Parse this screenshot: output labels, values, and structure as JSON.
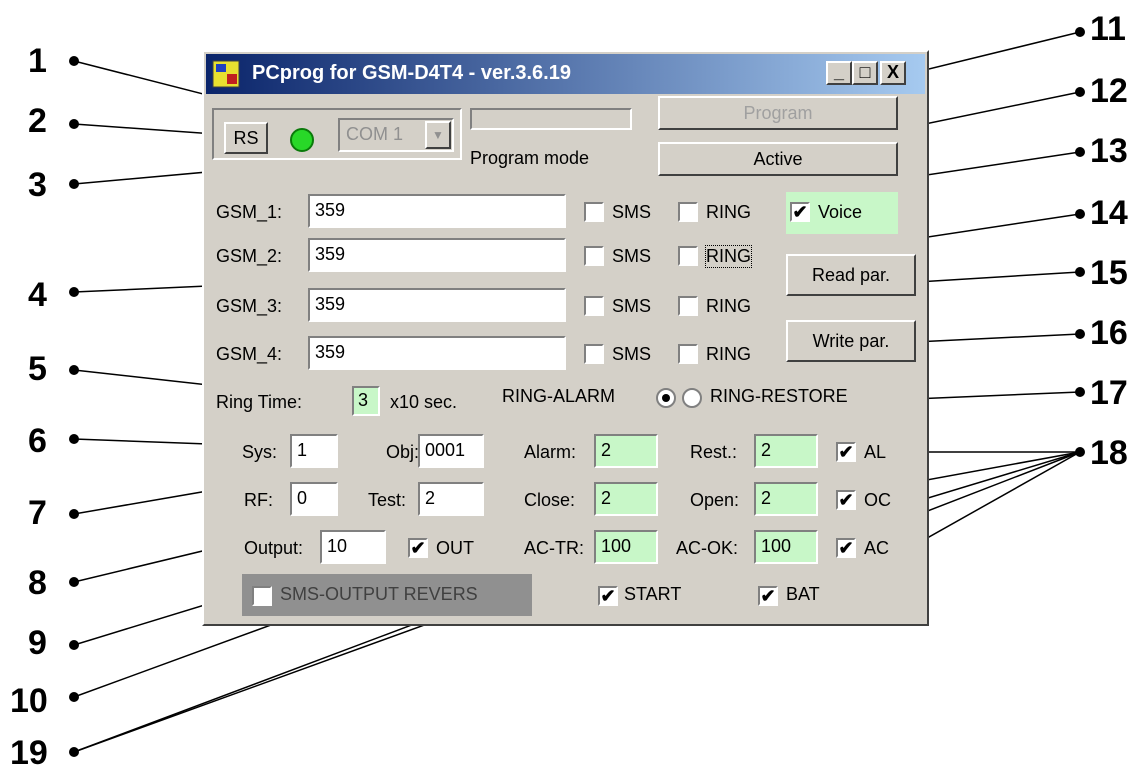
{
  "window": {
    "title": "PCprog for GSM-D4T4 - ver.3.6.19",
    "minimize": "_",
    "maximize": "□",
    "close": "X"
  },
  "port": {
    "button": "RS",
    "combo_value": "COM 1"
  },
  "mode": {
    "label": "Program mode"
  },
  "buttons": {
    "program": "Program",
    "active": "Active",
    "read": "Read par.",
    "write": "Write par."
  },
  "gsm": [
    {
      "label": "GSM_1:",
      "value": "359",
      "sms": "SMS",
      "ring": "RING"
    },
    {
      "label": "GSM_2:",
      "value": "359",
      "sms": "SMS",
      "ring": "RING"
    },
    {
      "label": "GSM_3:",
      "value": "359",
      "sms": "SMS",
      "ring": "RING"
    },
    {
      "label": "GSM_4:",
      "value": "359",
      "sms": "SMS",
      "ring": "RING"
    }
  ],
  "voice": {
    "label": "Voice",
    "checked": true
  },
  "ring_time": {
    "label": "Ring Time:",
    "value": "3",
    "unit": "x10 sec."
  },
  "ring_mode": {
    "alarm": "RING-ALARM",
    "restore": "RING-RESTORE",
    "selected": "alarm"
  },
  "params": {
    "sys_label": "Sys:",
    "sys": "1",
    "obj_label": "Obj:",
    "obj": "0001",
    "rf_label": "RF:",
    "rf": "0",
    "test_label": "Test:",
    "test": "2",
    "output_label": "Output:",
    "output": "10",
    "out_label": "OUT",
    "alarm_label": "Alarm:",
    "alarm": "2",
    "close_label": "Close:",
    "close": "2",
    "actr_label": "AC-TR:",
    "actr": "100",
    "rest_label": "Rest.:",
    "rest": "2",
    "open_label": "Open:",
    "open": "2",
    "acok_label": "AC-OK:",
    "acok": "100",
    "al_label": "AL",
    "oc_label": "OC",
    "ac_label": "AC",
    "start_label": "START",
    "bat_label": "BAT",
    "sms_revers_label": "SMS-OUTPUT REVERS"
  },
  "callouts": [
    "1",
    "2",
    "3",
    "4",
    "5",
    "6",
    "7",
    "8",
    "9",
    "10",
    "11",
    "12",
    "13",
    "14",
    "15",
    "16",
    "17",
    "18",
    "19"
  ],
  "colors": {
    "window_bg": "#d4d0c8",
    "green_field": "#c8f7c8",
    "title_blue": "#0a246a",
    "led": "#28d828"
  }
}
